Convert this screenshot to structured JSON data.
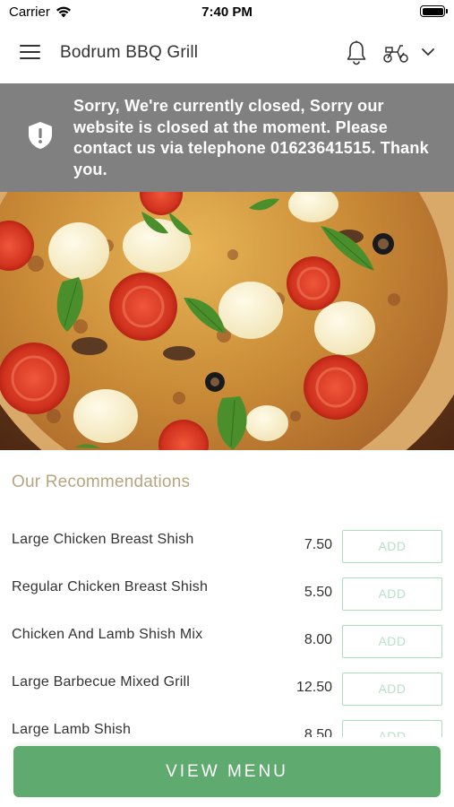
{
  "status_bar": {
    "carrier": "Carrier",
    "time": "7:40 PM"
  },
  "header": {
    "title": "Bodrum BBQ Grill",
    "icons": [
      "menu-icon",
      "bell-icon",
      "scooter-icon",
      "chevron-down-icon"
    ]
  },
  "closed_banner": {
    "message": "Sorry, We're currently closed, Sorry our website is closed at the moment. Please contact us via telephone 01623641515. Thank you.",
    "icon": "shield-icon"
  },
  "recommendations": {
    "title": "Our Recommendations",
    "add_label": "ADD",
    "items": [
      {
        "name": "Large Chicken Breast Shish",
        "price": "7.50"
      },
      {
        "name": "Regular Chicken Breast Shish",
        "price": "5.50"
      },
      {
        "name": "Chicken And Lamb Shish Mix",
        "price": "8.00"
      },
      {
        "name": "Large Barbecue Mixed Grill",
        "price": "12.50"
      },
      {
        "name": "Large Lamb Shish",
        "price": "8.50"
      }
    ]
  },
  "footer": {
    "view_menu_label": "VIEW MENU"
  },
  "colors": {
    "banner_bg": "#808080",
    "section_title": "#b8a57f",
    "add_border": "#a8dfc0",
    "view_menu_bg": "#5faa6e"
  }
}
